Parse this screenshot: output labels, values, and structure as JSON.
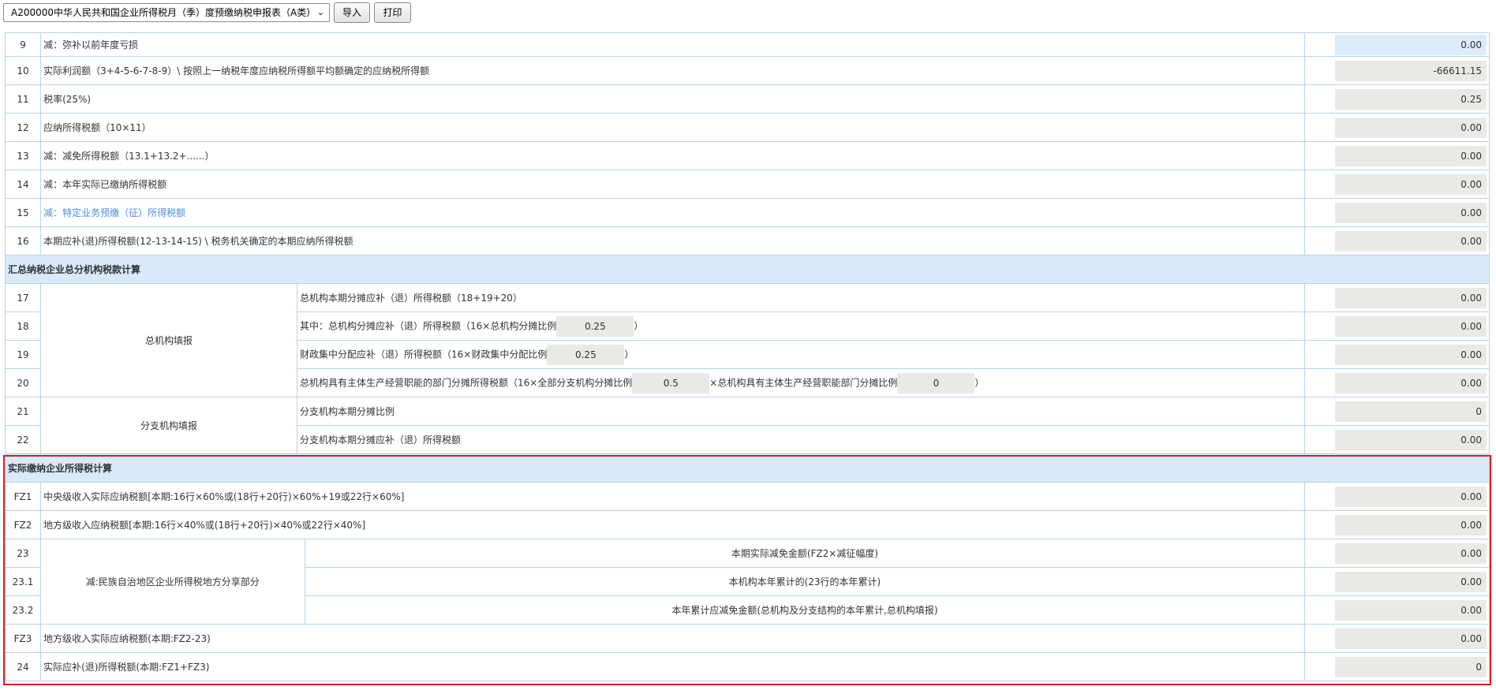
{
  "toolbar": {
    "select_value": "A200000中华人民共和国企业所得税月（季）度预缴纳税申报表（A类）",
    "import_label": "导入",
    "print_label": "打印"
  },
  "rows": {
    "r9": {
      "num": "9",
      "desc": "减：弥补以前年度亏损",
      "value": "0.00"
    },
    "r10": {
      "num": "10",
      "desc": "实际利润额（3+4-5-6-7-8-9）\\ 按照上一纳税年度应纳税所得额平均额确定的应纳税所得额",
      "value": "-66611.15"
    },
    "r11": {
      "num": "11",
      "desc": "税率(25%)",
      "value": "0.25"
    },
    "r12": {
      "num": "12",
      "desc": "应纳所得税额（10×11）",
      "value": "0.00"
    },
    "r13": {
      "num": "13",
      "desc": "减：减免所得税额（13.1+13.2+......）",
      "value": "0.00"
    },
    "r14": {
      "num": "14",
      "desc": "减：本年实际已缴纳所得税额",
      "value": "0.00"
    },
    "r15": {
      "num": "15",
      "desc": "减：特定业务预缴（征）所得税额",
      "value": "0.00"
    },
    "r16": {
      "num": "16",
      "desc": "本期应补(退)所得税额(12-13-14-15) \\ 税务机关确定的本期应纳所得税额",
      "value": "0.00"
    }
  },
  "section_hz": {
    "title": "汇总纳税企业总分机构税款计算",
    "group_head": "总机构填报",
    "group_branch": "分支机构填报",
    "r17": {
      "num": "17",
      "desc": "总机构本期分摊应补（退）所得税额（18+19+20）",
      "value": "0.00"
    },
    "r18": {
      "num": "18",
      "desc_a": "其中：总机构分摊应补（退）所得税额（16×总机构分摊比例",
      "ratio": "0.25",
      "desc_b": "）",
      "value": "0.00"
    },
    "r19": {
      "num": "19",
      "desc_a": "财政集中分配应补（退）所得税额（16×财政集中分配比例",
      "ratio": "0.25",
      "desc_b": "）",
      "value": "0.00"
    },
    "r20": {
      "num": "20",
      "desc_a": "总机构具有主体生产经营职能的部门分摊所得税额（16×全部分支机构分摊比例",
      "ratio1": "0.5",
      "desc_mid": "×总机构具有主体生产经营职能部门分摊比例",
      "ratio2": "0",
      "desc_b": "）",
      "value": "0.00"
    },
    "r21": {
      "num": "21",
      "desc": "分支机构本期分摊比例",
      "value": "0"
    },
    "r22": {
      "num": "22",
      "desc": "分支机构本期分摊应补（退）所得税额",
      "value": "0.00"
    }
  },
  "section_sj": {
    "title": "实际缴纳企业所得税计算",
    "group_minzu": "减:民族自治地区企业所得税地方分享部分",
    "fz1": {
      "num": "FZ1",
      "desc": "中央级收入实际应纳税额[本期:16行×60%或(18行+20行)×60%+19或22行×60%]",
      "value": "0.00"
    },
    "fz2": {
      "num": "FZ2",
      "desc": "地方级收入应纳税额[本期:16行×40%或(18行+20行)×40%或22行×40%]",
      "value": "0.00"
    },
    "r23": {
      "num": "23",
      "desc": "本期实际减免金额(FZ2×减征幅度)",
      "value": "0.00"
    },
    "r231": {
      "num": "23.1",
      "desc": "本机构本年累计的(23行的本年累计)",
      "value": "0.00"
    },
    "r232": {
      "num": "23.2",
      "desc": "本年累计应减免金额(总机构及分支结构的本年累计,总机构填报)",
      "value": "0.00"
    },
    "fz3": {
      "num": "FZ3",
      "desc": "地方级收入实际应纳税额(本期:FZ2-23)",
      "value": "0.00"
    },
    "r24": {
      "num": "24",
      "desc": "实际应补(退)所得税额(本期:FZ1+FZ3)",
      "value": "0"
    }
  }
}
